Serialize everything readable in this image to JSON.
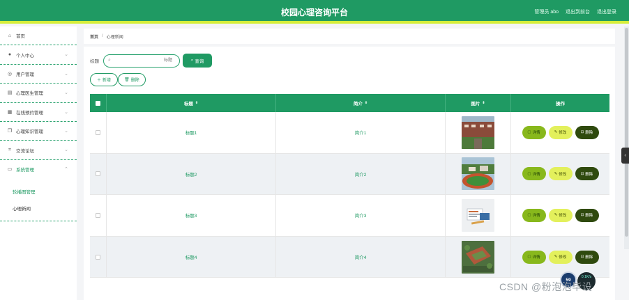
{
  "header": {
    "title": "校园心理咨询平台",
    "user": "管理员 abo",
    "to_front": "退出到前台",
    "logout": "退出登录"
  },
  "sidebar": {
    "items": [
      {
        "label": "首页",
        "icon": "home-icon",
        "chev": false
      },
      {
        "label": "个人中心",
        "icon": "user-icon",
        "chev": true
      },
      {
        "label": "用户管理",
        "icon": "users-icon",
        "chev": true
      },
      {
        "label": "心理医生管理",
        "icon": "doctor-icon",
        "chev": true
      },
      {
        "label": "在线预约管理",
        "icon": "calendar-icon",
        "chev": true
      },
      {
        "label": "心理知识管理",
        "icon": "book-icon",
        "chev": true
      },
      {
        "label": "交流论坛",
        "icon": "forum-icon",
        "chev": true
      },
      {
        "label": "系统管理",
        "icon": "system-icon",
        "chev": true
      }
    ],
    "submenu": [
      "轮播图管理",
      "心理新闻"
    ]
  },
  "breadcrumb": {
    "home": "首页",
    "sep": "/",
    "current": "心理新闻"
  },
  "search": {
    "label": "标题",
    "placeholder": "标题",
    "button": "查询"
  },
  "actions": {
    "add": "新增",
    "delete": "删除"
  },
  "table": {
    "columns": [
      "标题",
      "简介",
      "图片",
      "操作"
    ],
    "rows": [
      {
        "title": "标题1",
        "intro": "简介1",
        "image": "campus-buildings"
      },
      {
        "title": "标题2",
        "intro": "简介2",
        "image": "sports-field"
      },
      {
        "title": "标题3",
        "intro": "简介3",
        "image": "desk-items"
      },
      {
        "title": "标题4",
        "intro": "简介4",
        "image": "aerial-campus"
      }
    ],
    "ops": {
      "view": "详情",
      "edit": "修改",
      "del": "删除"
    }
  },
  "float": {
    "badge": "59",
    "speed": "0.1K/s"
  },
  "watermark": "CSDN @粉泡泡毕设",
  "colors": {
    "brand": "#1f9a63",
    "accent": "#d6ee3b",
    "view": "#88b81c",
    "edit": "#e3f05c",
    "del": "#2f4a0e"
  }
}
